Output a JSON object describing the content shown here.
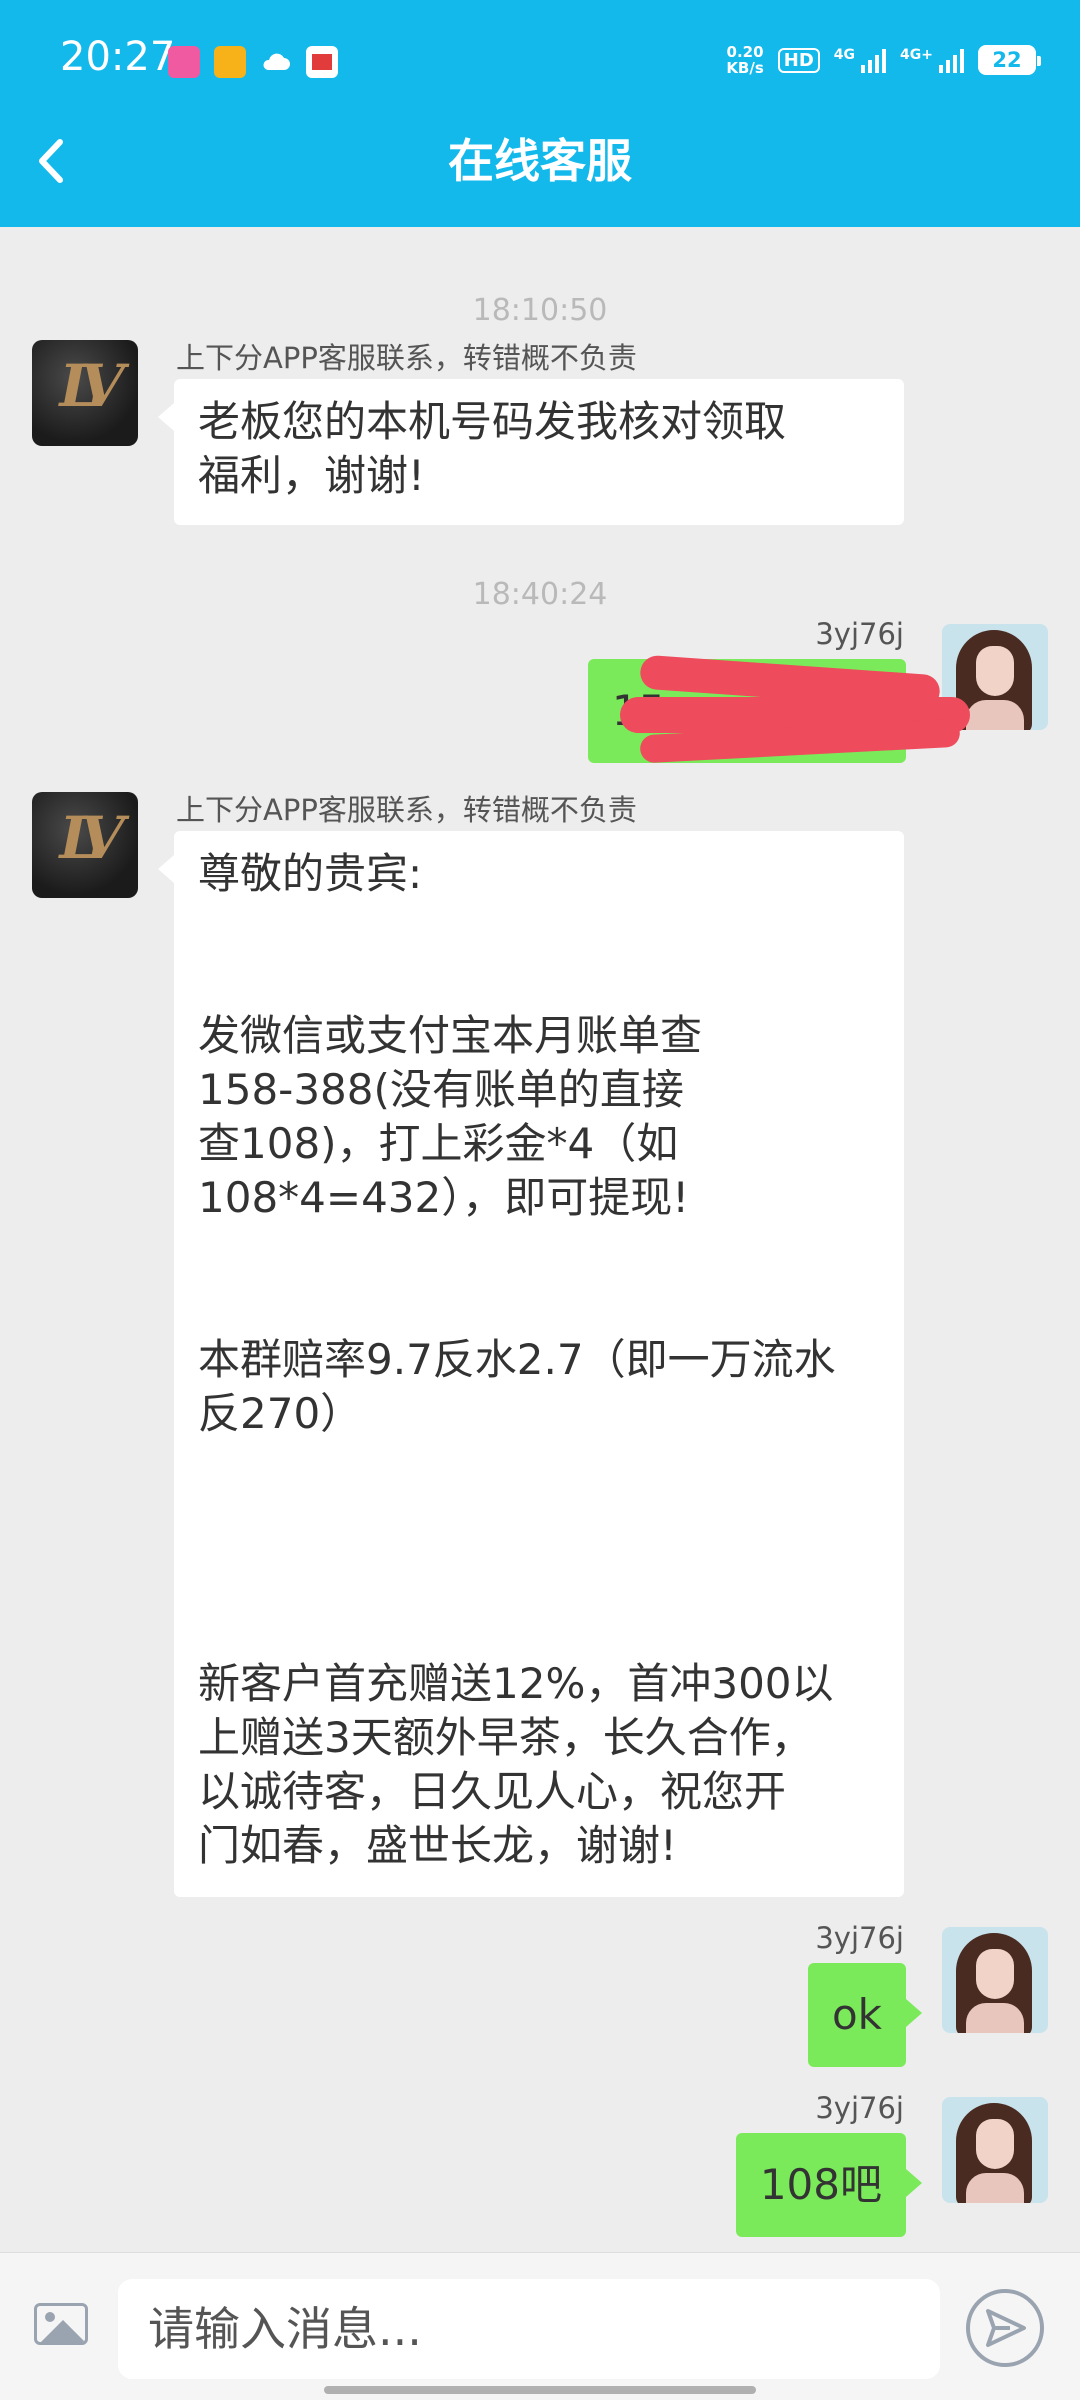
{
  "status_bar": {
    "time": "20:27",
    "net_speed_value": "0.20",
    "net_speed_unit": "KB/s",
    "hd": "HD",
    "sim1_label": "4G",
    "sim2_label": "4G+",
    "battery": "22"
  },
  "header": {
    "title": "在线客服"
  },
  "messages": {
    "ts1": "18:10:50",
    "msg1_sender": "上下分APP客服联系，转错概不负责",
    "msg1_text": "老板您的本机号码发我核对领取\n福利，谢谢!",
    "ts2": "18:40:24",
    "msg2_sender": "3yj76j",
    "msg2_text": "15",
    "msg3_sender": "上下分APP客服联系，转错概不负责",
    "msg3_text": "尊敬的贵宾:\n\n\n发微信或支付宝本月账单查\n158-388(没有账单的直接\n查108)，打上彩金*4（如\n108*4=432），即可提现!\n\n\n本群赔率9.7反水2.7（即一万流水\n反270）\n\n\n\n\n新客户首充赠送12%，首冲300以\n上赠送3天额外早茶，长久合作，\n以诚待客，日久见人心，祝您开\n门如春，盛世长龙，谢谢!",
    "msg4_sender": "3yj76j",
    "msg4_text": "ok",
    "msg5_sender": "3yj76j",
    "msg5_text": "108吧"
  },
  "input_bar": {
    "placeholder": "请输入消息..."
  }
}
